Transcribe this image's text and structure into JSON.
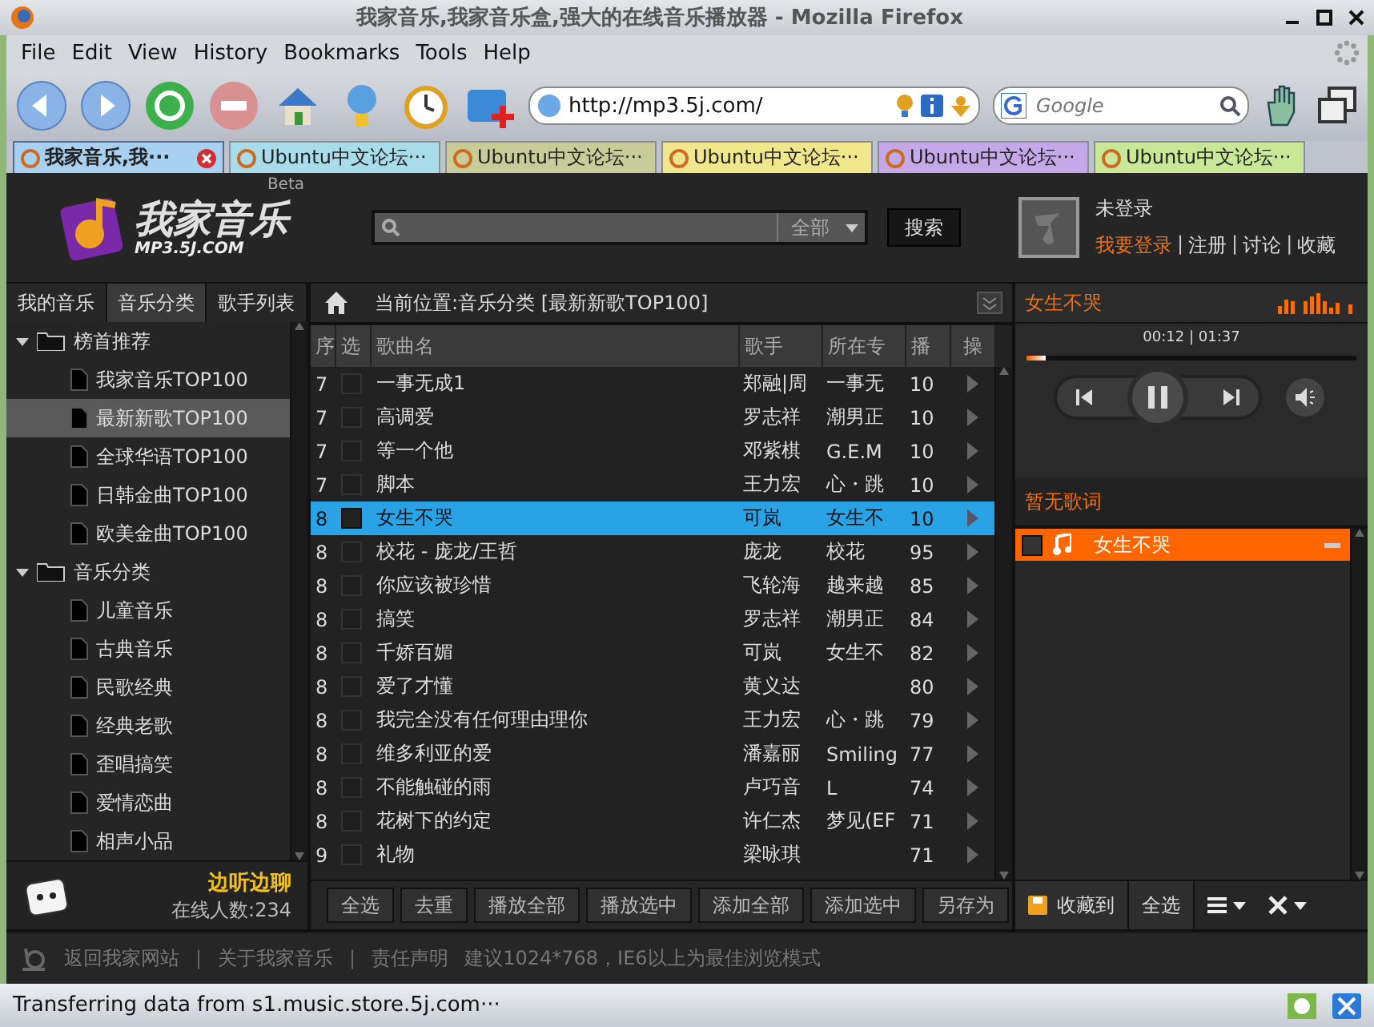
{
  "window": {
    "title": "我家音乐,我家音乐盒,强大的在线音乐播放器 - Mozilla Firefox"
  },
  "menu": [
    "File",
    "Edit",
    "View",
    "History",
    "Bookmarks",
    "Tools",
    "Help"
  ],
  "toolbar": {
    "url": "http://mp3.5j.com/",
    "search_placeholder": "Google"
  },
  "browser_tabs": [
    {
      "label": "我家音乐,我···",
      "selected": true,
      "color": "#a8d0f0"
    },
    {
      "label": "Ubuntu中文论坛···",
      "selected": false,
      "color": "#a8dce8"
    },
    {
      "label": "Ubuntu中文论坛···",
      "selected": false,
      "color": "#c8cc98"
    },
    {
      "label": "Ubuntu中文论坛···",
      "selected": false,
      "color": "#f0e68c"
    },
    {
      "label": "Ubuntu中文论坛···",
      "selected": false,
      "color": "#c4a8e8"
    },
    {
      "label": "Ubuntu中文论坛···",
      "selected": false,
      "color": "#c8e898"
    }
  ],
  "site": {
    "logo": {
      "name": "我家音乐",
      "domain": "MP3.5J.COM",
      "badge": "Beta"
    },
    "search": {
      "scope": "全部",
      "button": "搜索"
    },
    "user": {
      "status": "未登录",
      "separator": "|",
      "links": [
        {
          "label": "我要登录",
          "kind": "primary"
        },
        {
          "label": "注册",
          "kind": "plain"
        },
        {
          "label": "讨论",
          "kind": "plain"
        },
        {
          "label": "收藏",
          "kind": "plain"
        }
      ]
    }
  },
  "left_tabs": [
    {
      "label": "我的音乐",
      "selected": false
    },
    {
      "label": "音乐分类",
      "selected": true
    },
    {
      "label": "歌手列表",
      "selected": false
    }
  ],
  "tree": [
    {
      "label": "榜首推荐",
      "expanded": true,
      "children": [
        {
          "label": "我家音乐TOP100",
          "selected": false
        },
        {
          "label": "最新新歌TOP100",
          "selected": true
        },
        {
          "label": "全球华语TOP100",
          "selected": false
        },
        {
          "label": "日韩金曲TOP100",
          "selected": false
        },
        {
          "label": "欧美金曲TOP100",
          "selected": false
        }
      ]
    },
    {
      "label": "音乐分类",
      "expanded": true,
      "children": [
        {
          "label": "儿童音乐",
          "selected": false
        },
        {
          "label": "古典音乐",
          "selected": false
        },
        {
          "label": "民歌经典",
          "selected": false
        },
        {
          "label": "经典老歌",
          "selected": false
        },
        {
          "label": "歪唱搞笑",
          "selected": false
        },
        {
          "label": "爱情恋曲",
          "selected": false
        },
        {
          "label": "相声小品",
          "selected": false
        }
      ]
    }
  ],
  "chat": {
    "title": "边听边聊",
    "online": "在线人数:234"
  },
  "breadcrumb": "当前位置:音乐分类 [最新新歌TOP100]",
  "table": {
    "columns": [
      "序",
      "选",
      "歌曲名",
      "歌手",
      "所在专",
      "播",
      "操"
    ],
    "rows": [
      {
        "no": "7",
        "title": "一事无成1",
        "singer": "郑融|周",
        "album": "一事无",
        "plays": "10",
        "selected": false
      },
      {
        "no": "7",
        "title": "高调爱",
        "singer": "罗志祥",
        "album": "潮男正",
        "plays": "10",
        "selected": false
      },
      {
        "no": "7",
        "title": "等一个他",
        "singer": "邓紫棋",
        "album": "G.E.M",
        "plays": "10",
        "selected": false
      },
      {
        "no": "7",
        "title": "脚本",
        "singer": "王力宏",
        "album": "心・跳",
        "plays": "10",
        "selected": false
      },
      {
        "no": "8",
        "title": "女生不哭",
        "singer": "可岚",
        "album": "女生不",
        "plays": "10",
        "selected": true
      },
      {
        "no": "8",
        "title": "校花 - 庞龙/王哲",
        "singer": "庞龙",
        "album": "校花",
        "plays": "95",
        "selected": false
      },
      {
        "no": "8",
        "title": "你应该被珍惜",
        "singer": "飞轮海",
        "album": "越来越",
        "plays": "85",
        "selected": false
      },
      {
        "no": "8",
        "title": "搞笑",
        "singer": "罗志祥",
        "album": "潮男正",
        "plays": "84",
        "selected": false
      },
      {
        "no": "8",
        "title": "千娇百媚",
        "singer": "可岚",
        "album": "女生不",
        "plays": "82",
        "selected": false
      },
      {
        "no": "8",
        "title": "爱了才懂",
        "singer": "黄义达",
        "plays": "80",
        "selected": false
      },
      {
        "no": "8",
        "title": "我完全没有任何理由理你",
        "singer": "王力宏",
        "album": "心・跳",
        "plays": "79",
        "selected": false
      },
      {
        "no": "8",
        "title": "维多利亚的爱",
        "singer": "潘嘉丽",
        "album": "Smiling",
        "plays": "77",
        "selected": false
      },
      {
        "no": "8",
        "title": "不能触碰的雨",
        "singer": "卢巧音",
        "album": "L",
        "plays": "74",
        "selected": false
      },
      {
        "no": "8",
        "title": "花树下的约定",
        "singer": "许仁杰",
        "album": "梦见(EF",
        "plays": "71",
        "selected": false
      },
      {
        "no": "9",
        "title": "礼物",
        "singer": "梁咏琪",
        "plays": "71",
        "selected": false
      }
    ]
  },
  "actions": [
    "全选",
    "去重",
    "播放全部",
    "播放选中",
    "添加全部",
    "添加选中",
    "另存为"
  ],
  "player": {
    "now_playing": "女生不哭",
    "time": "00:12 | 01:37",
    "level": 0.06,
    "playing": true,
    "lyrics": "暂无歌词"
  },
  "playlist": [
    {
      "title": "女生不哭",
      "selected": true
    }
  ],
  "playlist_bar": {
    "collect": "收藏到",
    "select_all": "全选"
  },
  "footer": {
    "separator": "|",
    "links": [
      "返回我家网站",
      "关于我家音乐",
      "责任声明"
    ],
    "note": "建议1024*768，IE6以上为最佳浏览模式"
  },
  "status_bar": "Transferring data from s1.music.store.5j.com···"
}
